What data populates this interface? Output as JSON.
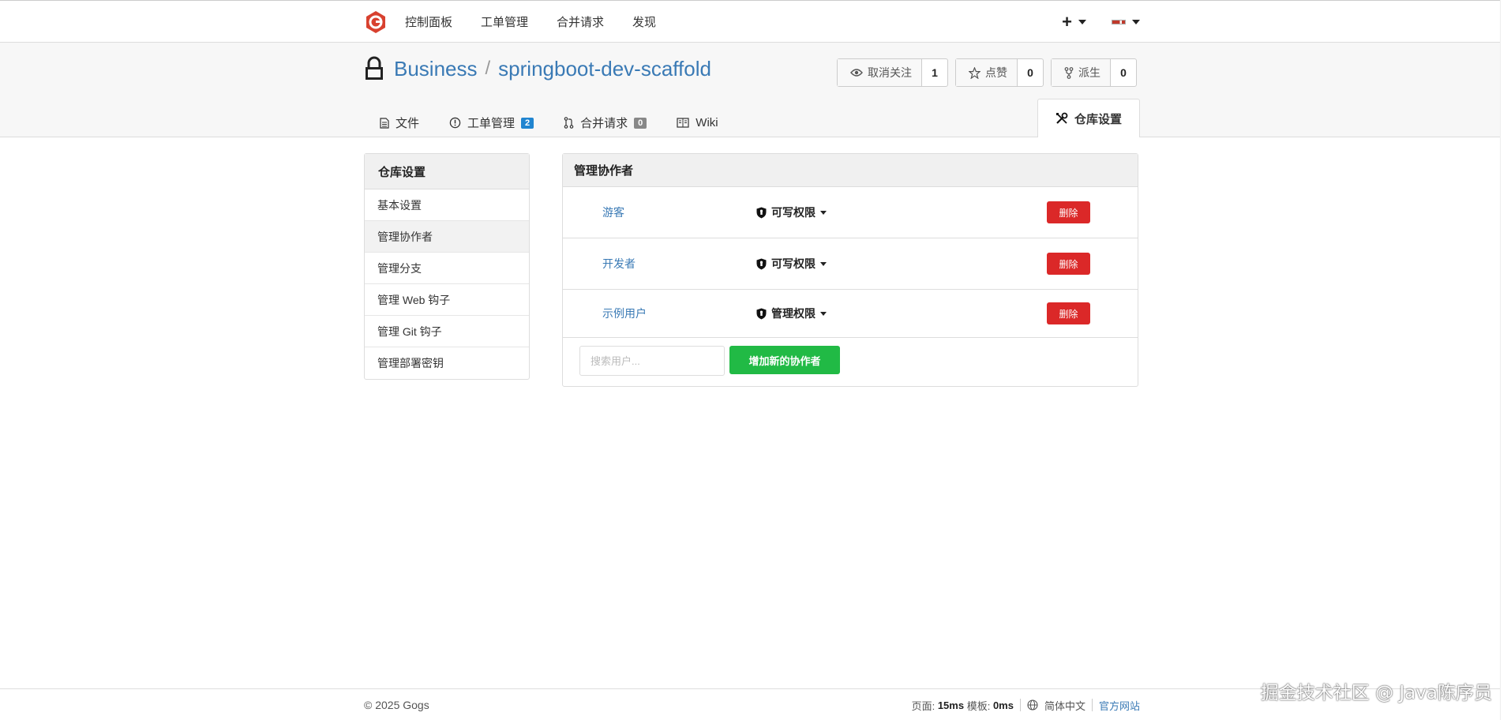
{
  "topbar": {
    "nav": [
      "控制面板",
      "工单管理",
      "合并请求",
      "发现"
    ],
    "plus_icon": "plus-icon",
    "colors": {
      "logo": "#d8412f"
    }
  },
  "repo": {
    "owner": "Business",
    "separator": "/",
    "name": "springboot-dev-scaffold",
    "buttons": {
      "watch": {
        "label": "取消关注",
        "count": "1"
      },
      "star": {
        "label": "点赞",
        "count": "0"
      },
      "fork": {
        "label": "派生",
        "count": "0"
      }
    },
    "tabs": {
      "files": "文件",
      "issues": "工单管理",
      "issues_count": "2",
      "pulls": "合并请求",
      "pulls_count": "0",
      "wiki": "Wiki",
      "settings": "仓库设置"
    }
  },
  "sidebar": {
    "title": "仓库设置",
    "items": [
      "基本设置",
      "管理协作者",
      "管理分支",
      "管理 Web 钩子",
      "管理 Git 钩子",
      "管理部署密钥"
    ]
  },
  "collaborators": {
    "title": "管理协作者",
    "rows": [
      {
        "name": "游客",
        "permission": "可写权限",
        "delete_label": "删除"
      },
      {
        "name": "开发者",
        "permission": "可写权限",
        "delete_label": "删除"
      },
      {
        "name": "示例用户",
        "permission": "管理权限",
        "delete_label": "删除"
      }
    ],
    "search_placeholder": "搜索用户...",
    "add_label": "增加新的协作者",
    "colors": {
      "delete": "#db2828",
      "add": "#21ba45",
      "link": "#3a7ab5"
    }
  },
  "footer": {
    "copyright": "© 2025 Gogs",
    "page_label": "页面:",
    "page_time": "15ms",
    "template_label": "模板:",
    "template_time": "0ms",
    "language": "简体中文",
    "official_site": "官方网站"
  },
  "watermark": "掘金技术社区 @ Java陈序员"
}
